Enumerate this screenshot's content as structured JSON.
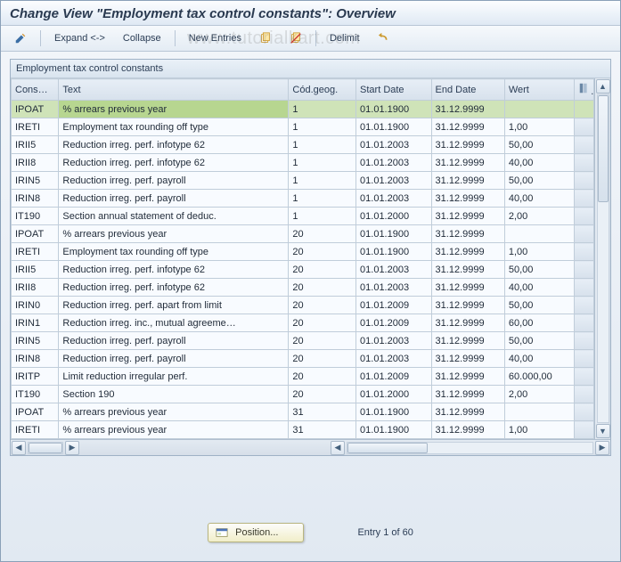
{
  "title": "Change View \"Employment tax control constants\": Overview",
  "watermark": "www.tutorialkart.com",
  "toolbar": {
    "change": "pencil-icon",
    "expand": "Expand <->",
    "collapse": "Collapse",
    "new_entries": "New Entries",
    "copy": "copy-icon",
    "delete": "delete-icon",
    "delimit": "Delimit",
    "undo": "undo-icon"
  },
  "panel": {
    "title": "Employment tax control constants"
  },
  "columns": {
    "cons": "Cons…",
    "text": "Text",
    "geog": "Cód.geog.",
    "start": "Start Date",
    "end": "End Date",
    "wert": "Wert",
    "sel": "select-column-icon"
  },
  "rows": [
    {
      "cons": "IPOAT",
      "text": "% arrears previous year",
      "geog": "1",
      "start": "01.01.1900",
      "end": "31.12.9999",
      "wert": ""
    },
    {
      "cons": "IRETI",
      "text": "Employment tax rounding off type",
      "geog": "1",
      "start": "01.01.1900",
      "end": "31.12.9999",
      "wert": "1,00"
    },
    {
      "cons": "IRII5",
      "text": "Reduction irreg. perf. infotype 62",
      "geog": "1",
      "start": "01.01.2003",
      "end": "31.12.9999",
      "wert": "50,00"
    },
    {
      "cons": "IRII8",
      "text": "Reduction irreg. perf. infotype 62",
      "geog": "1",
      "start": "01.01.2003",
      "end": "31.12.9999",
      "wert": "40,00"
    },
    {
      "cons": "IRIN5",
      "text": "Reduction irreg. perf. payroll",
      "geog": "1",
      "start": "01.01.2003",
      "end": "31.12.9999",
      "wert": "50,00"
    },
    {
      "cons": "IRIN8",
      "text": "Reduction irreg. perf. payroll",
      "geog": "1",
      "start": "01.01.2003",
      "end": "31.12.9999",
      "wert": "40,00"
    },
    {
      "cons": "IT190",
      "text": "Section annual statement of deduc.",
      "geog": "1",
      "start": "01.01.2000",
      "end": "31.12.9999",
      "wert": "2,00"
    },
    {
      "cons": "IPOAT",
      "text": "% arrears previous year",
      "geog": "20",
      "start": "01.01.1900",
      "end": "31.12.9999",
      "wert": ""
    },
    {
      "cons": "IRETI",
      "text": "Employment tax rounding off type",
      "geog": "20",
      "start": "01.01.1900",
      "end": "31.12.9999",
      "wert": "1,00"
    },
    {
      "cons": "IRII5",
      "text": "Reduction irreg. perf. infotype 62",
      "geog": "20",
      "start": "01.01.2003",
      "end": "31.12.9999",
      "wert": "50,00"
    },
    {
      "cons": "IRII8",
      "text": "Reduction irreg. perf. infotype 62",
      "geog": "20",
      "start": "01.01.2003",
      "end": "31.12.9999",
      "wert": "40,00"
    },
    {
      "cons": "IRIN0",
      "text": "Reduction irreg. perf. apart from limit",
      "geog": "20",
      "start": "01.01.2009",
      "end": "31.12.9999",
      "wert": "50,00"
    },
    {
      "cons": "IRIN1",
      "text": "Reduction irreg. inc., mutual agreeme…",
      "geog": "20",
      "start": "01.01.2009",
      "end": "31.12.9999",
      "wert": "60,00"
    },
    {
      "cons": "IRIN5",
      "text": "Reduction irreg. perf. payroll",
      "geog": "20",
      "start": "01.01.2003",
      "end": "31.12.9999",
      "wert": "50,00"
    },
    {
      "cons": "IRIN8",
      "text": "Reduction irreg. perf. payroll",
      "geog": "20",
      "start": "01.01.2003",
      "end": "31.12.9999",
      "wert": "40,00"
    },
    {
      "cons": "IRITP",
      "text": "Limit reduction irregular perf.",
      "geog": "20",
      "start": "01.01.2009",
      "end": "31.12.9999",
      "wert": "60.000,00"
    },
    {
      "cons": "IT190",
      "text": "Section 190",
      "geog": "20",
      "start": "01.01.2000",
      "end": "31.12.9999",
      "wert": "2,00"
    },
    {
      "cons": "IPOAT",
      "text": "% arrears previous year",
      "geog": "31",
      "start": "01.01.1900",
      "end": "31.12.9999",
      "wert": ""
    },
    {
      "cons": "IRETI",
      "text": "% arrears previous year",
      "geog": "31",
      "start": "01.01.1900",
      "end": "31.12.9999",
      "wert": "1,00"
    }
  ],
  "footer": {
    "position": "Position...",
    "entry": "Entry 1 of 60"
  }
}
